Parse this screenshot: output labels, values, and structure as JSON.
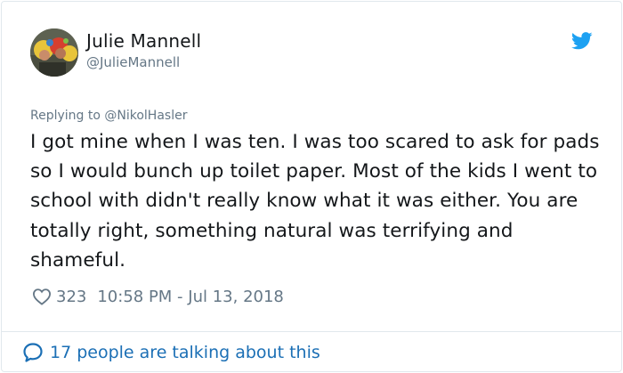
{
  "tweet": {
    "author": {
      "display_name": "Julie Mannell",
      "handle": "@JulieMannell"
    },
    "replying_to": "Replying to @NikolHasler",
    "text": "I got mine when I was ten. I was too scared to ask for pads so I would bunch up toilet paper. Most of the kids I went to school with didn't really know what it was either. You are totally right, something natural was terrifying and shameful.",
    "like_count": "323",
    "timestamp": "10:58 PM - Jul 13, 2018",
    "conversation_link": "17 people are talking about this"
  },
  "icons": {
    "brand": "twitter-bird-icon",
    "like": "heart-icon",
    "conversation": "speech-bubble-icon"
  },
  "colors": {
    "twitter_blue": "#1da1f2",
    "link_blue": "#1b6fb5",
    "muted_gray": "#657786",
    "text": "#14171a",
    "border": "#e1e8ed"
  }
}
